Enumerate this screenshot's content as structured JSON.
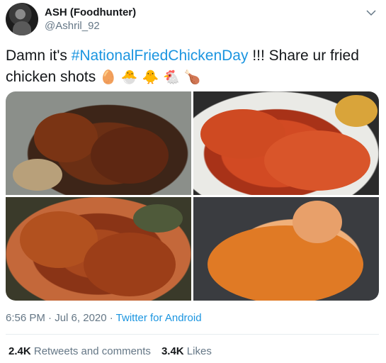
{
  "author": {
    "name": "ASH (Foodhunter)",
    "handle": "@Ashril_92"
  },
  "tweet": {
    "text_before": "Damn it's ",
    "hashtag": "#NationalFriedChickenDay",
    "text_after": " !!! Share ur fried chicken shots ",
    "emojis": "🥚 🐣 🐥 🐔 🍗"
  },
  "photos": [
    {
      "icon": "photo",
      "color": "#6b2f14"
    },
    {
      "icon": "photo",
      "color": "#d24a23"
    },
    {
      "icon": "photo",
      "color": "#a8481e"
    },
    {
      "icon": "photo",
      "color": "#e0741f"
    }
  ],
  "meta": {
    "time": "6:56 PM",
    "separator": " · ",
    "date": "Jul 6, 2020",
    "source": "Twitter for Android"
  },
  "stats": {
    "retweets_count": "2.4K",
    "retweets_label": "Retweets and comments",
    "likes_count": "3.4K",
    "likes_label": "Likes"
  },
  "colors": {
    "link": "#1b95e0",
    "secondary_text": "#657786"
  }
}
